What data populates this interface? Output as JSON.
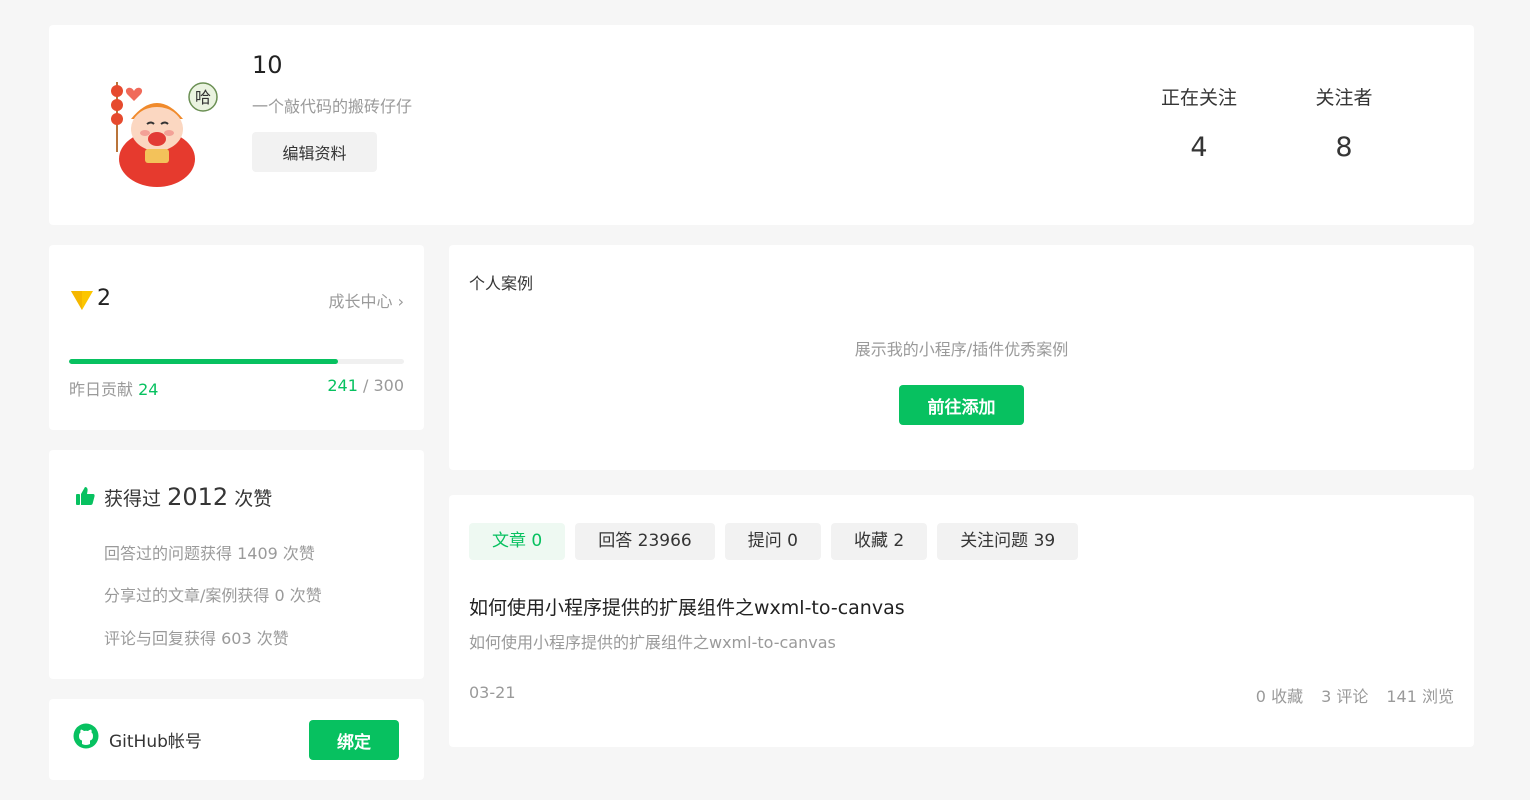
{
  "profile": {
    "name": "10",
    "bio": "一个敲代码的搬砖仔仔",
    "edit_label": "编辑资料",
    "following_label": "正在关注",
    "following_count": "4",
    "followers_label": "关注者",
    "followers_count": "8"
  },
  "level": {
    "value": "2",
    "growth_link": "成长中心 ›",
    "yesterday_label": "昨日贡献",
    "yesterday_value": "24",
    "current": "241",
    "separator": " / ",
    "total": "300",
    "progress_fraction": 0.803
  },
  "likes": {
    "prefix": "获得过",
    "total": "2012",
    "suffix": "次赞",
    "rows": [
      "回答过的问题获得 1409 次赞",
      "分享过的文章/案例获得 0 次赞",
      "评论与回复获得 603 次赞"
    ]
  },
  "github": {
    "label": "GitHub帐号",
    "bind_label": "绑定"
  },
  "cases": {
    "title": "个人案例",
    "empty_text": "展示我的小程序/插件优秀案例",
    "add_label": "前往添加"
  },
  "content": {
    "tabs": [
      "文章 0",
      "回答 23966",
      "提问 0",
      "收藏 2",
      "关注问题 39"
    ],
    "article": {
      "title": "如何使用小程序提供的扩展组件之wxml-to-canvas",
      "desc": "如何使用小程序提供的扩展组件之wxml-to-canvas",
      "date": "03-21",
      "favorites": "0 收藏",
      "comments": "3 评论",
      "views": "141 浏览"
    }
  },
  "colors": {
    "accent": "#07c160",
    "background": "#f6f6f6",
    "muted": "#9a9a9a",
    "level_badge": "#fcc600"
  }
}
